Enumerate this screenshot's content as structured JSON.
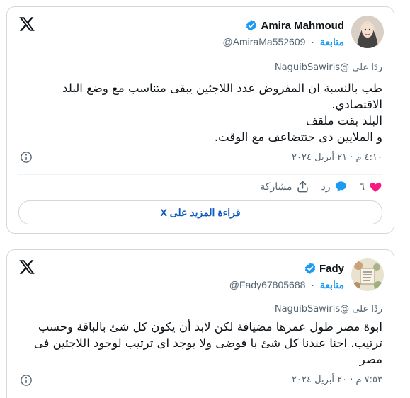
{
  "accent": "#1d9bf0",
  "tweets": [
    {
      "display_name": "Amira Mahmoud",
      "handle": "@AmiraMa552609",
      "follow_label": "متابعة",
      "dot": "·",
      "reply_to": "ردًا على @NaguibSawiris",
      "body": "طب بالنسبة ان المفروض عدد اللاجئين يبقى متناسب مع وضع البلد الاقتصادي.\nالبلد بقت ملقف\nو الملايين دى حتتضاعف مع الوقت.",
      "timestamp": "٤:١٠ م · ٢١ أبريل ٢٠٢٤",
      "likes": "٦",
      "reply_label": "رد",
      "share_label": "مشاركة",
      "read_more": "قراءة المزيد على X"
    },
    {
      "display_name": "Fady",
      "handle": "@Fady67805688",
      "follow_label": "متابعة",
      "dot": "·",
      "reply_to": "ردًا على @NaguibSawiris",
      "body": "ابوة مصر طول عمرها مضيافة لكن لابد أن يكون كل شئ بالباقة وحسب ترتيب. احنا عندنا كل شئ با فوضى ولا يوجد اى ترتيب لوجود اللاجئين فى مصر",
      "timestamp": "٧:٥٣ م · ٢٠ أبريل ٢٠٢٤"
    }
  ]
}
